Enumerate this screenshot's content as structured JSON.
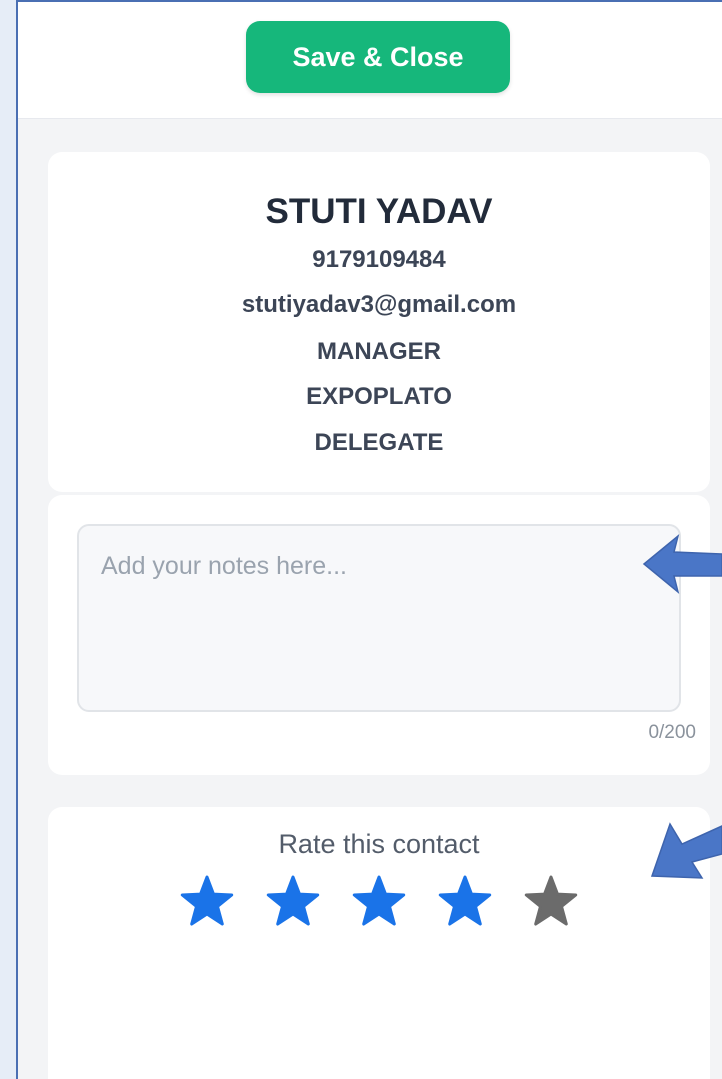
{
  "toolbar": {
    "save_close_label": "Save & Close",
    "save_color": "#16b77b"
  },
  "contact": {
    "name": "STUTI YADAV",
    "phone": "9179109484",
    "email": "stutiyadav3@gmail.com",
    "designation": "MANAGER",
    "company": "EXPOPLATO",
    "category": "DELEGATE"
  },
  "notes": {
    "value": "",
    "placeholder": "Add your notes here...",
    "counter": "0/200"
  },
  "rating": {
    "title": "Rate this contact",
    "value": 4,
    "max": 5,
    "filled_color": "#1a73e8",
    "empty_color": "#6b6b6b",
    "icon": "star-icon"
  },
  "annotations": {
    "arrow_color": "#4a76c7",
    "icon": "callout-arrow-icon"
  }
}
